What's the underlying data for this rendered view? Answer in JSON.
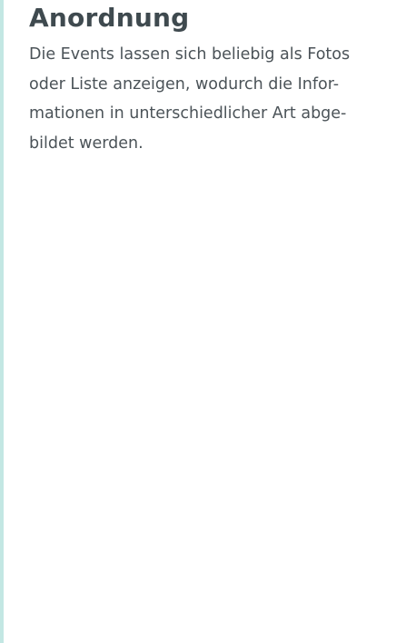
{
  "section": {
    "title": "Anordnung",
    "lines": [
      "Die Events lassen sich beliebig als Fotos",
      "oder Liste anzeigen, wodurch die Infor-",
      "mationen in unterschiedlicher Art abge-",
      "bildet werden."
    ]
  },
  "colors": {
    "accent_line": "#c3e7e3",
    "title": "#3f4a4f",
    "body": "#4b5358",
    "background": "#ffffff"
  }
}
